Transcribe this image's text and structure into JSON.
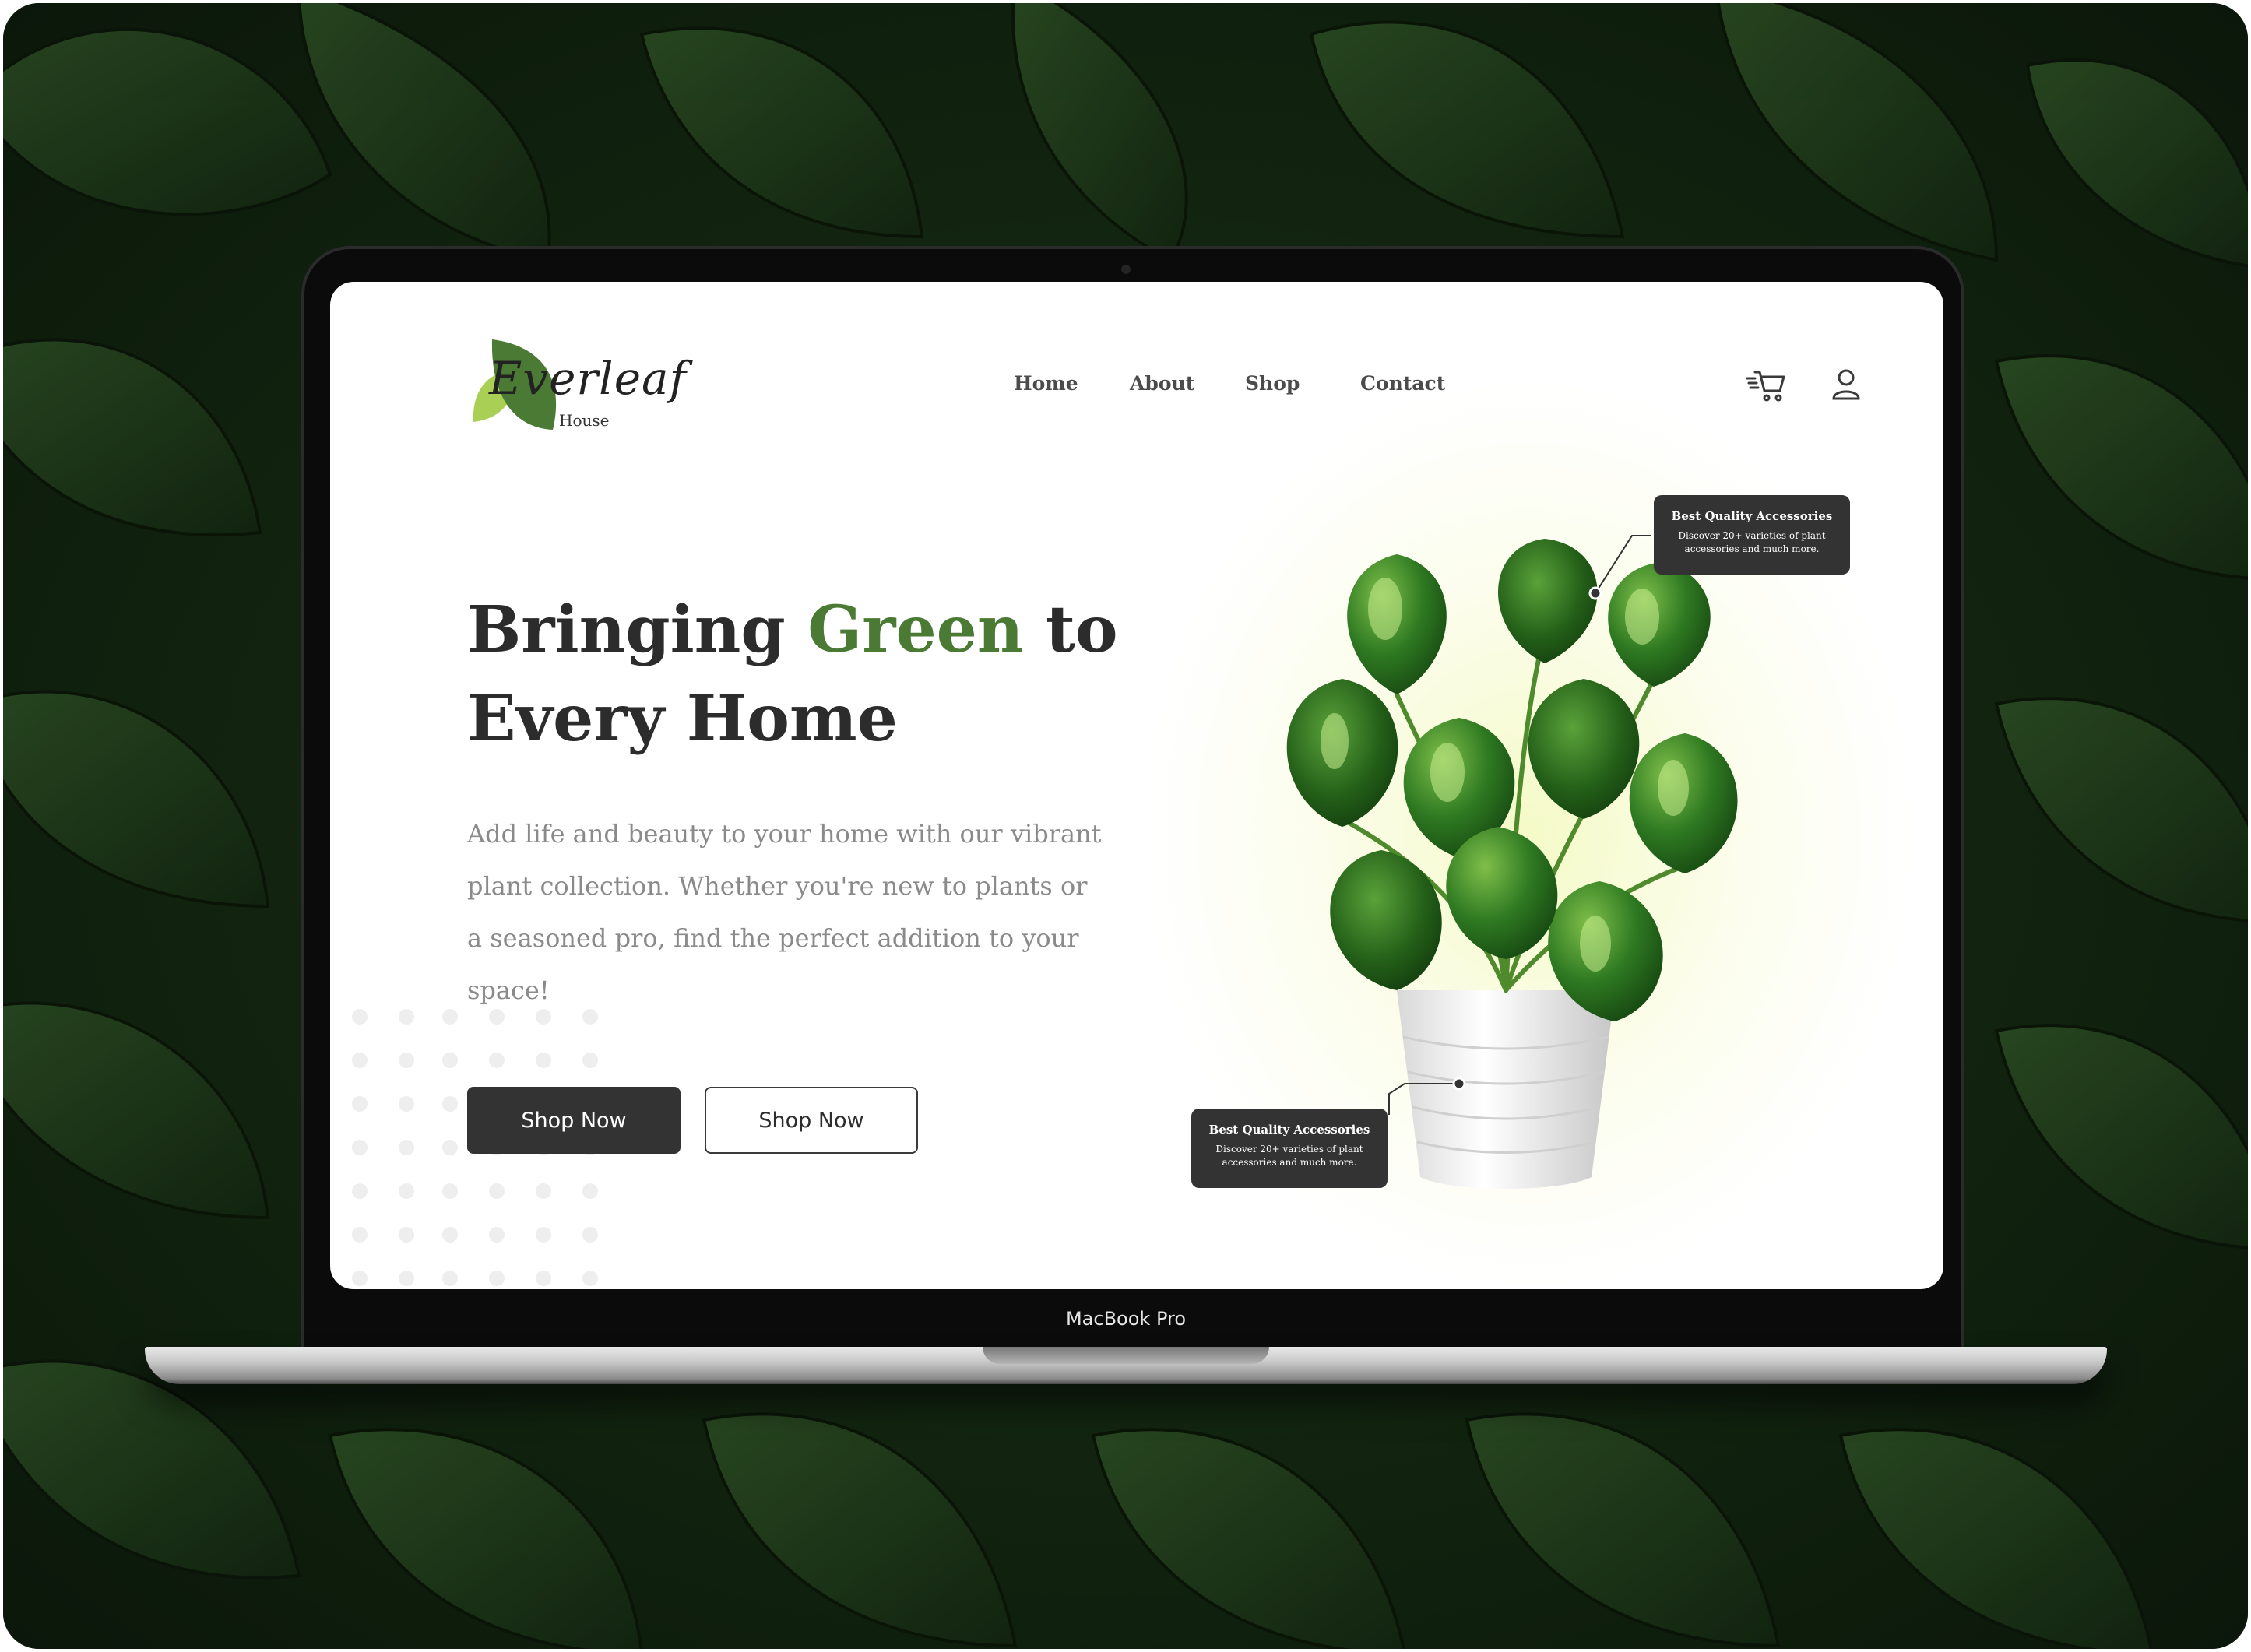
{
  "device": {
    "label": "MacBook Pro"
  },
  "brand": {
    "script": "Everleaf",
    "sub": "House",
    "colors": {
      "leaf_dark": "#4a7a33",
      "leaf_light": "#a9cf55"
    }
  },
  "nav": {
    "items": [
      {
        "label": "Home"
      },
      {
        "label": "About"
      },
      {
        "label": "Shop"
      },
      {
        "label": "Contact"
      }
    ],
    "icons": {
      "cart": "cart-icon",
      "user": "user-icon"
    }
  },
  "hero": {
    "title_pre": "Bringing ",
    "title_accent": "Green",
    "title_post": " to Every Home",
    "description": "Add life and beauty to your home with our vibrant plant collection. Whether you're new to plants or a seasoned pro, find the perfect addition to your space!",
    "primary_button": "Shop Now",
    "secondary_button": "Shop Now"
  },
  "callouts": [
    {
      "title": "Best Quality Accessories",
      "body": "Discover 20+ varieties of plant accessories and much more."
    },
    {
      "title": "Best Quality Accessories",
      "body": "Discover 20+ varieties of plant accessories and much more."
    }
  ],
  "colors": {
    "accent": "#4a7a33",
    "dark_button": "#333333",
    "text_dark": "#2c2c2c",
    "text_muted": "#8a8a8a",
    "backdrop": "#0e1d0c"
  }
}
